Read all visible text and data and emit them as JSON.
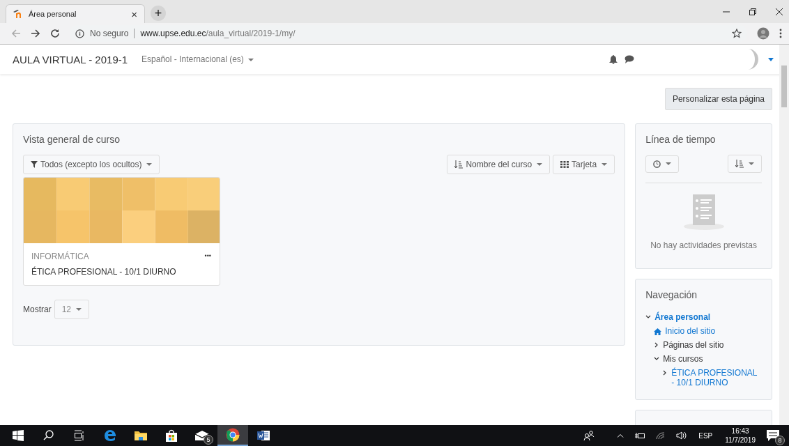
{
  "browser": {
    "tab": {
      "title": "Área personal",
      "close": "×"
    },
    "new_tab": "+",
    "address": {
      "security": "No seguro",
      "host": "www.upse.edu.ec",
      "path": "/aula_virtual/2019-1/my/"
    }
  },
  "navbar": {
    "site": "AULA VIRTUAL - 2019-1",
    "language": "Español - Internacional (es)"
  },
  "customize_button": "Personalizar esta página",
  "overview": {
    "title": "Vista general de curso",
    "filter": "Todos (excepto los ocultos)",
    "sort": "Nombre del curso",
    "view": "Tarjeta",
    "courses": [
      {
        "category": "INFORMÁTICA",
        "name": "ÉTICA PROFESIONAL - 10/1 DIURNO",
        "menu": "•••"
      }
    ],
    "show_label": "Mostrar",
    "show_count": "12"
  },
  "timeline": {
    "title": "Línea de tiempo",
    "empty": "No hay actividades previstas"
  },
  "navigation": {
    "title": "Navegación",
    "items": [
      {
        "label": "Área personal",
        "kind": "branch",
        "expanded": true,
        "link": true,
        "selected": true,
        "children": [
          {
            "label": "Inicio del sitio",
            "kind": "home",
            "link": true,
            "selected": false
          },
          {
            "label": "Páginas del sitio",
            "kind": "branch",
            "expanded": false,
            "link": false,
            "selected": false
          },
          {
            "label": "Mis cursos",
            "kind": "branch",
            "expanded": true,
            "link": false,
            "selected": false,
            "children": [
              {
                "label": "ÉTICA PROFESIONAL - 10/1 DIURNO",
                "kind": "branch",
                "expanded": false,
                "link": true,
                "selected": false
              }
            ]
          }
        ]
      }
    ]
  },
  "taskbar": {
    "items": [
      {
        "kind": "start",
        "selected": false
      },
      {
        "kind": "search",
        "selected": false
      },
      {
        "kind": "taskview",
        "selected": false
      },
      {
        "kind": "edge",
        "selected": false
      },
      {
        "kind": "folder",
        "selected": false
      },
      {
        "kind": "store",
        "selected": false
      },
      {
        "kind": "mail",
        "selected": false,
        "badge": "5"
      },
      {
        "kind": "chrome",
        "selected": true
      },
      {
        "kind": "word",
        "selected": false
      }
    ],
    "language": "ESP",
    "time": "16:43",
    "date": "11/7/2019",
    "notifications": "8"
  }
}
